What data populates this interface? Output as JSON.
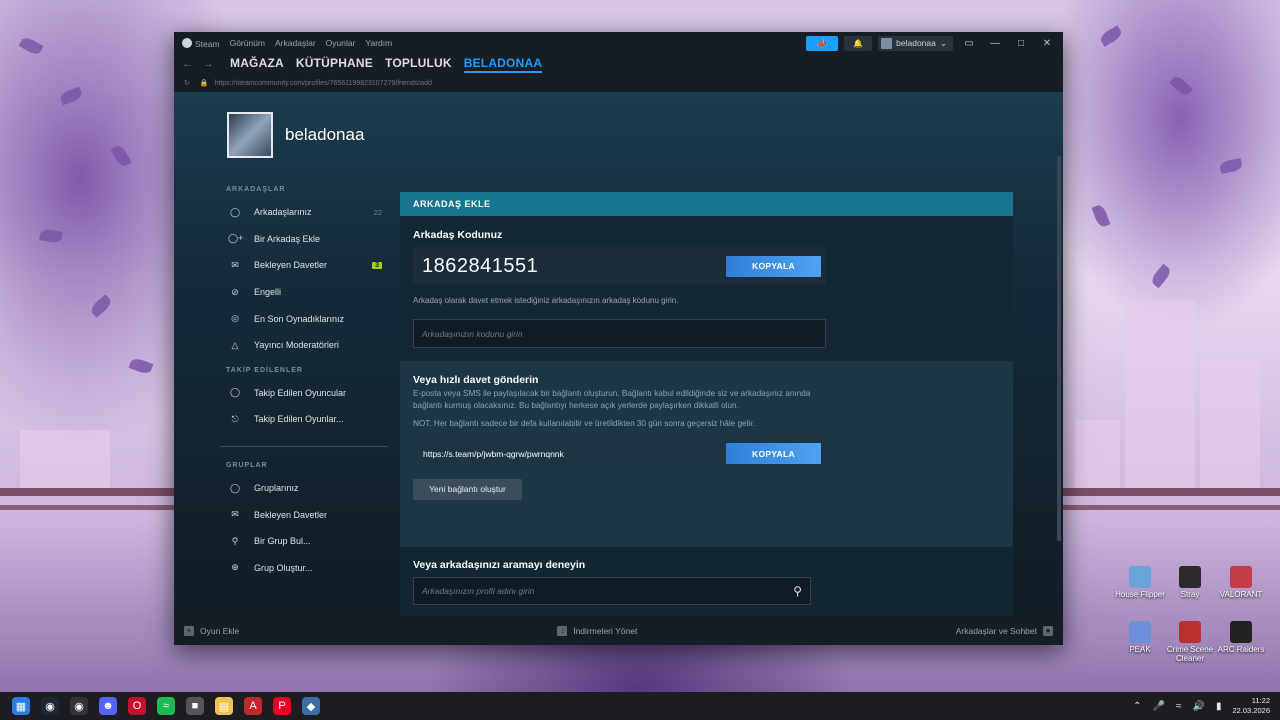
{
  "window": {
    "menu": [
      "Steam",
      "Görünüm",
      "Arkadaşlar",
      "Oyunlar",
      "Yardım"
    ],
    "user": "beladonaa",
    "tabs": [
      {
        "label": "MAĞAZA",
        "active": false
      },
      {
        "label": "KÜTÜPHANE",
        "active": false
      },
      {
        "label": "TOPLULUK",
        "active": false
      },
      {
        "label": "BELADONAA",
        "active": true
      }
    ],
    "url": "https://steamcommunity.com/profiles/76561199823107279/friends/add"
  },
  "profile": {
    "name": "beladonaa"
  },
  "sidebar": {
    "friends_heading": "ARKADAŞLAR",
    "friends_items": [
      {
        "label": "Arkadaşlarınız",
        "icon": "person-icon",
        "count": "22"
      },
      {
        "label": "Bir Arkadaş Ekle",
        "icon": "person-add-icon"
      },
      {
        "label": "Bekleyen Davetler",
        "icon": "envelope-icon",
        "badge": "3"
      },
      {
        "label": "Engelli",
        "icon": "block-icon"
      },
      {
        "label": "En Son Oynadıklarınız",
        "icon": "recent-icon"
      },
      {
        "label": "Yayıncı Moderatörleri",
        "icon": "moderator-icon"
      }
    ],
    "following_heading": "TAKİP EDİLENLER",
    "following_items": [
      {
        "label": "Takip Edilen Oyuncular",
        "icon": "followed-players-icon"
      },
      {
        "label": "Takip Edilen Oyunlar...",
        "icon": "followed-games-icon"
      }
    ],
    "groups_heading": "GRUPLAR",
    "groups_items": [
      {
        "label": "Gruplarınız",
        "icon": "groups-icon"
      },
      {
        "label": "Bekleyen Davetler",
        "icon": "envelope-icon"
      },
      {
        "label": "Bir Grup Bul...",
        "icon": "search-icon"
      },
      {
        "label": "Grup Oluştur...",
        "icon": "plus-circle-icon"
      }
    ]
  },
  "panel": {
    "header": "ARKADAŞ EKLE",
    "code_title": "Arkadaş Kodunuz",
    "code_value": "1862841551",
    "copy_label": "KOPYALA",
    "code_hint": "Arkadaş olarak davet etmek istediğiniz arkadaşınızın arkadaş kodunu girin.",
    "code_placeholder": "Arkadaşınızın kodunu girin",
    "invite_title": "Veya hızlı davet gönderin",
    "invite_text": "E-posta veya SMS ile paylaşılacak bir bağlantı oluşturun. Bağlantı kabul edildiğinde siz ve arkadaşınız anında bağlantı kurmuş olacaksınız. Bu bağlantıyı herkese açık yerlerde paylaşırken dikkatli olun.",
    "invite_note": "NOT: Her bağlantı sadece bir defa kullanılabilir ve üretildikten 30 gün sonra geçersiz hâle gelir.",
    "invite_link": "https://s.team/p/jwbm-qgrw/pwrnqnnk",
    "invite_copy_label": "KOPYALA",
    "new_link_label": "Yeni bağlantı oluştur",
    "search_title": "Veya arkadaşınızı aramayı deneyin",
    "search_placeholder": "Arkadaşınızın profil adını girin"
  },
  "bottombar": {
    "add_game": "Oyun Ekle",
    "downloads": "İndirmeleri Yönet",
    "friends_chat": "Arkadaşlar ve Sohbet"
  },
  "desktop_icons": [
    {
      "label": "House Flipper",
      "color": "#6aa4d8"
    },
    {
      "label": "Stray",
      "color": "#2a2a2a"
    },
    {
      "label": "VALORANT",
      "color": "#c43b4a"
    },
    {
      "label": "PEAK",
      "color": "#6c8fd9"
    },
    {
      "label": "Crime Scene Cleaner",
      "color": "#b83030"
    },
    {
      "label": "ARC Raiders",
      "color": "#222222"
    }
  ],
  "taskbar": {
    "time": "11:22",
    "date": "22.03.2026"
  }
}
